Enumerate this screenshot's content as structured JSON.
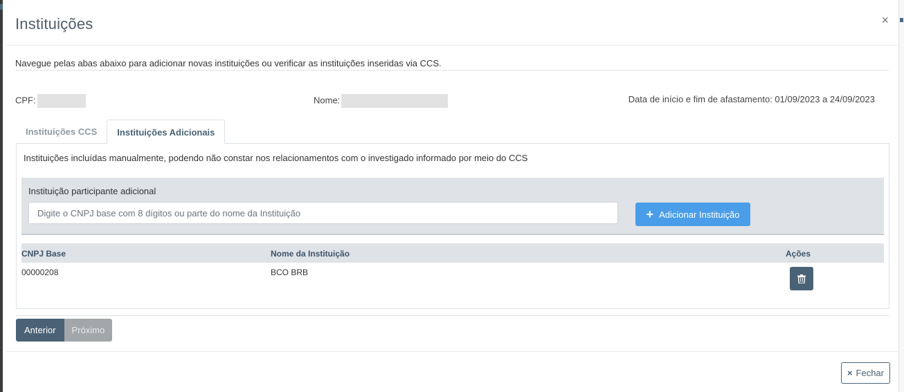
{
  "modal": {
    "title": "Instituições",
    "close_symbol": "×"
  },
  "intro_text": "Navegue pelas abas abaixo para adicionar novas instituições ou verificar as instituições inseridas via CCS.",
  "info": {
    "cpf_label": "CPF:",
    "cpf_value": "",
    "nome_label": "Nome:",
    "nome_value": "",
    "datas": "Data de início e fim de afastamento: 01/09/2023 a 24/09/2023"
  },
  "tabs": [
    {
      "label": "Instituições CCS",
      "active": false
    },
    {
      "label": "Instituições Adicionais",
      "active": true
    }
  ],
  "panel": {
    "description": "Instituições incluídas manualmente, podendo não constar nos relacionamentos com o investigado informado por meio do CCS",
    "form": {
      "label": "Instituição participante adicional",
      "placeholder": "Digite o CNPJ base com 8 dígitos ou parte do nome da Instituição",
      "value": "",
      "add_button_label": "Adicionar Instituição"
    },
    "table": {
      "columns": [
        "CNPJ Base",
        "Nome da Instituição",
        "Ações"
      ],
      "rows": [
        {
          "cnpj": "00000208",
          "nome": "BCO BRB",
          "action_icon": "trash-icon"
        }
      ]
    }
  },
  "pager": {
    "prev_label": "Anterior",
    "next_label": "Próximo"
  },
  "footer": {
    "close_label": "Fechar",
    "close_icon": "×"
  },
  "colors": {
    "primary_dark": "#4a6275",
    "accent_blue": "#4a9de8",
    "disabled_gray": "#a3a7ab"
  }
}
